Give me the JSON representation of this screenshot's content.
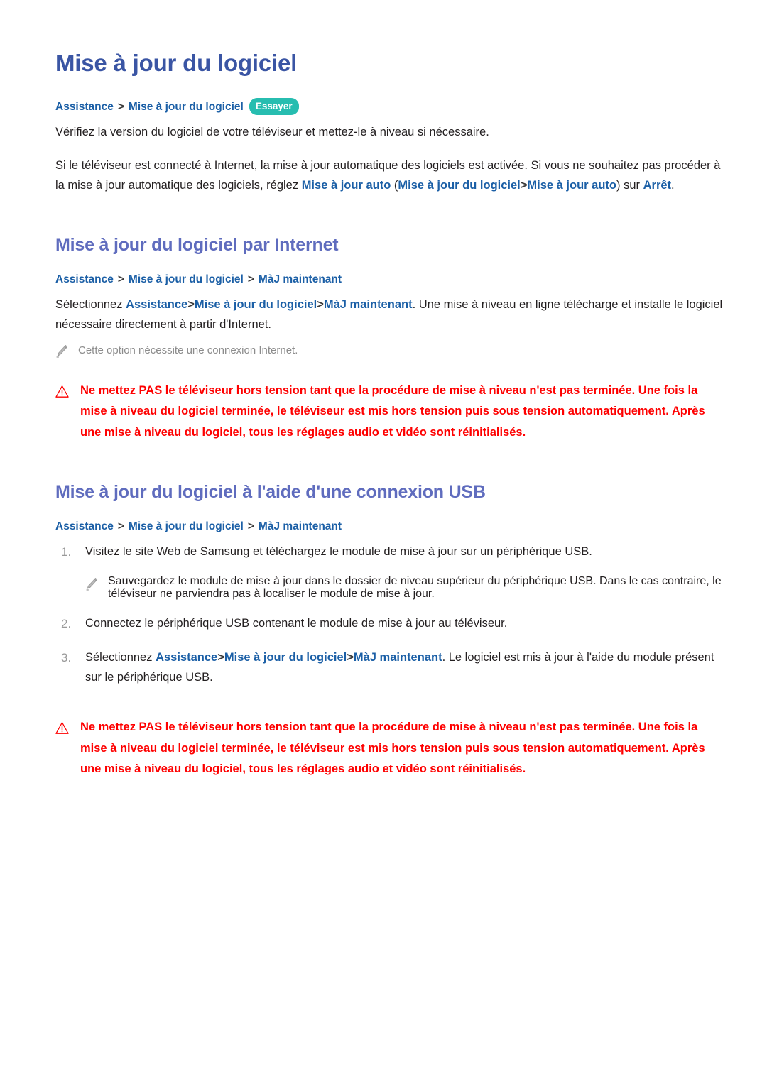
{
  "page": {
    "title": "Mise à jour du logiciel"
  },
  "colors": {
    "h1": "#3a55a4",
    "h2": "#5f6cbe",
    "link": "#1b5fa6",
    "badge": "#27bdb0",
    "warning": "#fe0000",
    "note": "#8c8c8c",
    "body": "#231f20",
    "list_number": "#9a9a9a"
  },
  "section1": {
    "heading": "Mise à jour du logiciel",
    "breadcrumb": {
      "crumbs": [
        "Assistance",
        "Mise à jour du logiciel"
      ],
      "separator": ">",
      "badge": "Essayer"
    },
    "paragraph1": "Vérifiez la version du logiciel de votre téléviseur et mettez-le à niveau si nécessaire.",
    "paragraph2": {
      "part1": "Si le téléviseur est connecté à Internet, la mise à jour automatique des logiciels est activée. Si vous ne souhaitez pas procéder à la mise à jour automatique des logiciels, réglez ",
      "link1": "Mise à jour auto",
      "part2": " (",
      "link2": "Mise à jour du logiciel",
      "sep": ">",
      "link3": "Mise à jour auto",
      "part3": ") sur ",
      "link4": "Arrêt",
      "part4": "."
    }
  },
  "section2": {
    "heading": "Mise à jour du logiciel par Internet",
    "breadcrumb": {
      "crumbs": [
        "Assistance",
        "Mise à jour du logiciel",
        "MàJ maintenant"
      ],
      "separator": ">"
    },
    "paragraph": {
      "part1": "Sélectionnez ",
      "link1": "Assistance",
      "sep": ">",
      "link2": "Mise à jour du logiciel",
      "link3": "MàJ maintenant",
      "part2": ". Une mise à niveau en ligne télécharge et installe le logiciel nécessaire directement à partir d'Internet."
    },
    "note": {
      "icon": "pencil-icon",
      "text": "Cette option nécessite une connexion Internet."
    },
    "warning": {
      "icon": "warning-triangle-icon",
      "lines": [
        "Ne mettez PAS le téléviseur hors tension tant que la procédure de mise à niveau n'est pas terminée. Une fois",
        "la mise à niveau du logiciel terminée, le téléviseur est mis hors tension puis sous tension automatiquement.",
        "Après une mise à niveau du logiciel, tous les réglages audio et vidéo sont réinitialisés."
      ]
    }
  },
  "section3": {
    "heading": "Mise à jour du logiciel à l'aide d'une connexion USB",
    "breadcrumb": {
      "crumbs": [
        "Assistance",
        "Mise à jour du logiciel",
        "MàJ maintenant"
      ],
      "separator": ">"
    },
    "steps": [
      {
        "number": "1.",
        "text": "Visitez le site Web de Samsung et téléchargez le module de mise à jour sur un périphérique USB."
      },
      {
        "number": "2.",
        "text": "Connectez le périphérique USB contenant le module de mise à jour au téléviseur."
      },
      {
        "number": "3.",
        "text": ""
      }
    ],
    "step1_note": {
      "icon": "pencil-icon",
      "text": "Sauvegardez le module de mise à jour dans le dossier de niveau supérieur du périphérique USB. Dans le cas contraire, le téléviseur ne parviendra pas à localiser le module de mise à jour."
    },
    "step3": {
      "number": "3.",
      "part1": "Sélectionnez ",
      "link1": "Assistance",
      "sep": ">",
      "link2": "Mise à jour du logiciel",
      "link3": "MàJ maintenant",
      "part2": ". Le logiciel est mis à jour à l'aide du module présent sur le périphérique USB."
    },
    "warning": {
      "icon": "warning-triangle-icon",
      "lines": [
        "Ne mettez PAS le téléviseur hors tension tant que la procédure de mise à niveau n'est pas terminée. Une fois",
        "la mise à niveau du logiciel terminée, le téléviseur est mis hors tension puis sous tension automatiquement.",
        "Après une mise à niveau du logiciel, tous les réglages audio et vidéo sont réinitialisés."
      ]
    }
  }
}
